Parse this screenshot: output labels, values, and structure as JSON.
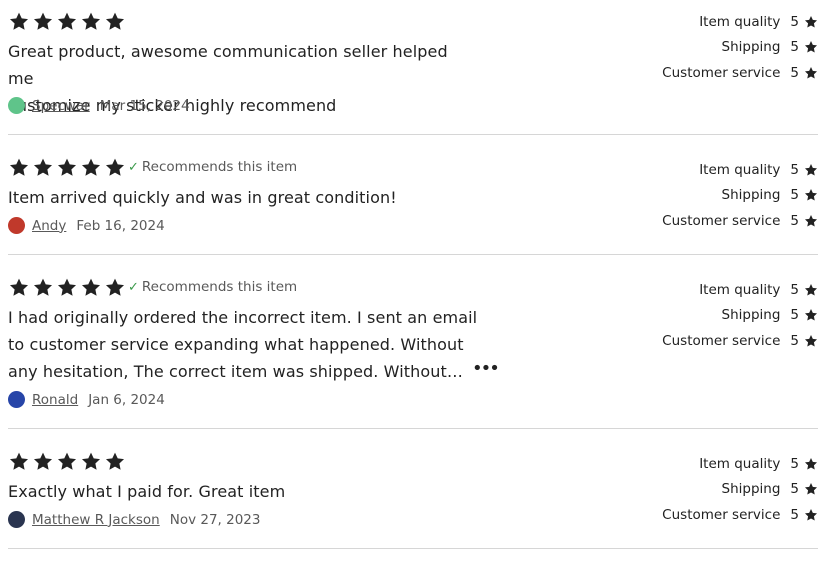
{
  "reviews": [
    {
      "rating": 5,
      "recommends": false,
      "text_lines": [
        "Great product, awesome communication seller helped me",
        "customize my sticker highly recommend"
      ],
      "author": "Specwar",
      "date": "Mar 15, 2024",
      "avatar_color": "#5fc48a",
      "sub_ratings": [
        {
          "label": "Item quality",
          "value": "5"
        },
        {
          "label": "Shipping",
          "value": "5"
        },
        {
          "label": "Customer service",
          "value": "5"
        }
      ]
    },
    {
      "rating": 5,
      "recommends": true,
      "recommend_label": "Recommends this item",
      "text_lines": [
        "Item arrived quickly and was in great condition!"
      ],
      "author": "Andy",
      "date": "Feb 16, 2024",
      "avatar_color": "#c0392b",
      "sub_ratings": [
        {
          "label": "Item quality",
          "value": "5"
        },
        {
          "label": "Shipping",
          "value": "5"
        },
        {
          "label": "Customer service",
          "value": "5"
        }
      ]
    },
    {
      "rating": 5,
      "recommends": true,
      "recommend_label": "Recommends this item",
      "text_lines": [
        "I had originally ordered the incorrect item. I sent an email",
        "to customer service expanding what happened. Without",
        "any hesitation, The correct item was shipped. Without…"
      ],
      "author": "Ronald",
      "date": "Jan 6, 2024",
      "avatar_color": "#2745a8",
      "sub_ratings": [
        {
          "label": "Item quality",
          "value": "5"
        },
        {
          "label": "Shipping",
          "value": "5"
        },
        {
          "label": "Customer service",
          "value": "5"
        }
      ]
    },
    {
      "rating": 5,
      "recommends": false,
      "text_lines": [
        "Exactly what I paid for. Great item"
      ],
      "author": "Matthew R Jackson",
      "date": "Nov 27, 2023",
      "avatar_color": "#2a3550",
      "sub_ratings": [
        {
          "label": "Item quality",
          "value": "5"
        },
        {
          "label": "Shipping",
          "value": "5"
        },
        {
          "label": "Customer service",
          "value": "5"
        }
      ]
    }
  ],
  "icons": {
    "star": "star-icon",
    "check": "check-icon",
    "more": "more-icon"
  },
  "colors": {
    "star": "#222222",
    "check": "#3a9a4a",
    "meta_text": "#595959",
    "divider": "#d6d6d6"
  }
}
